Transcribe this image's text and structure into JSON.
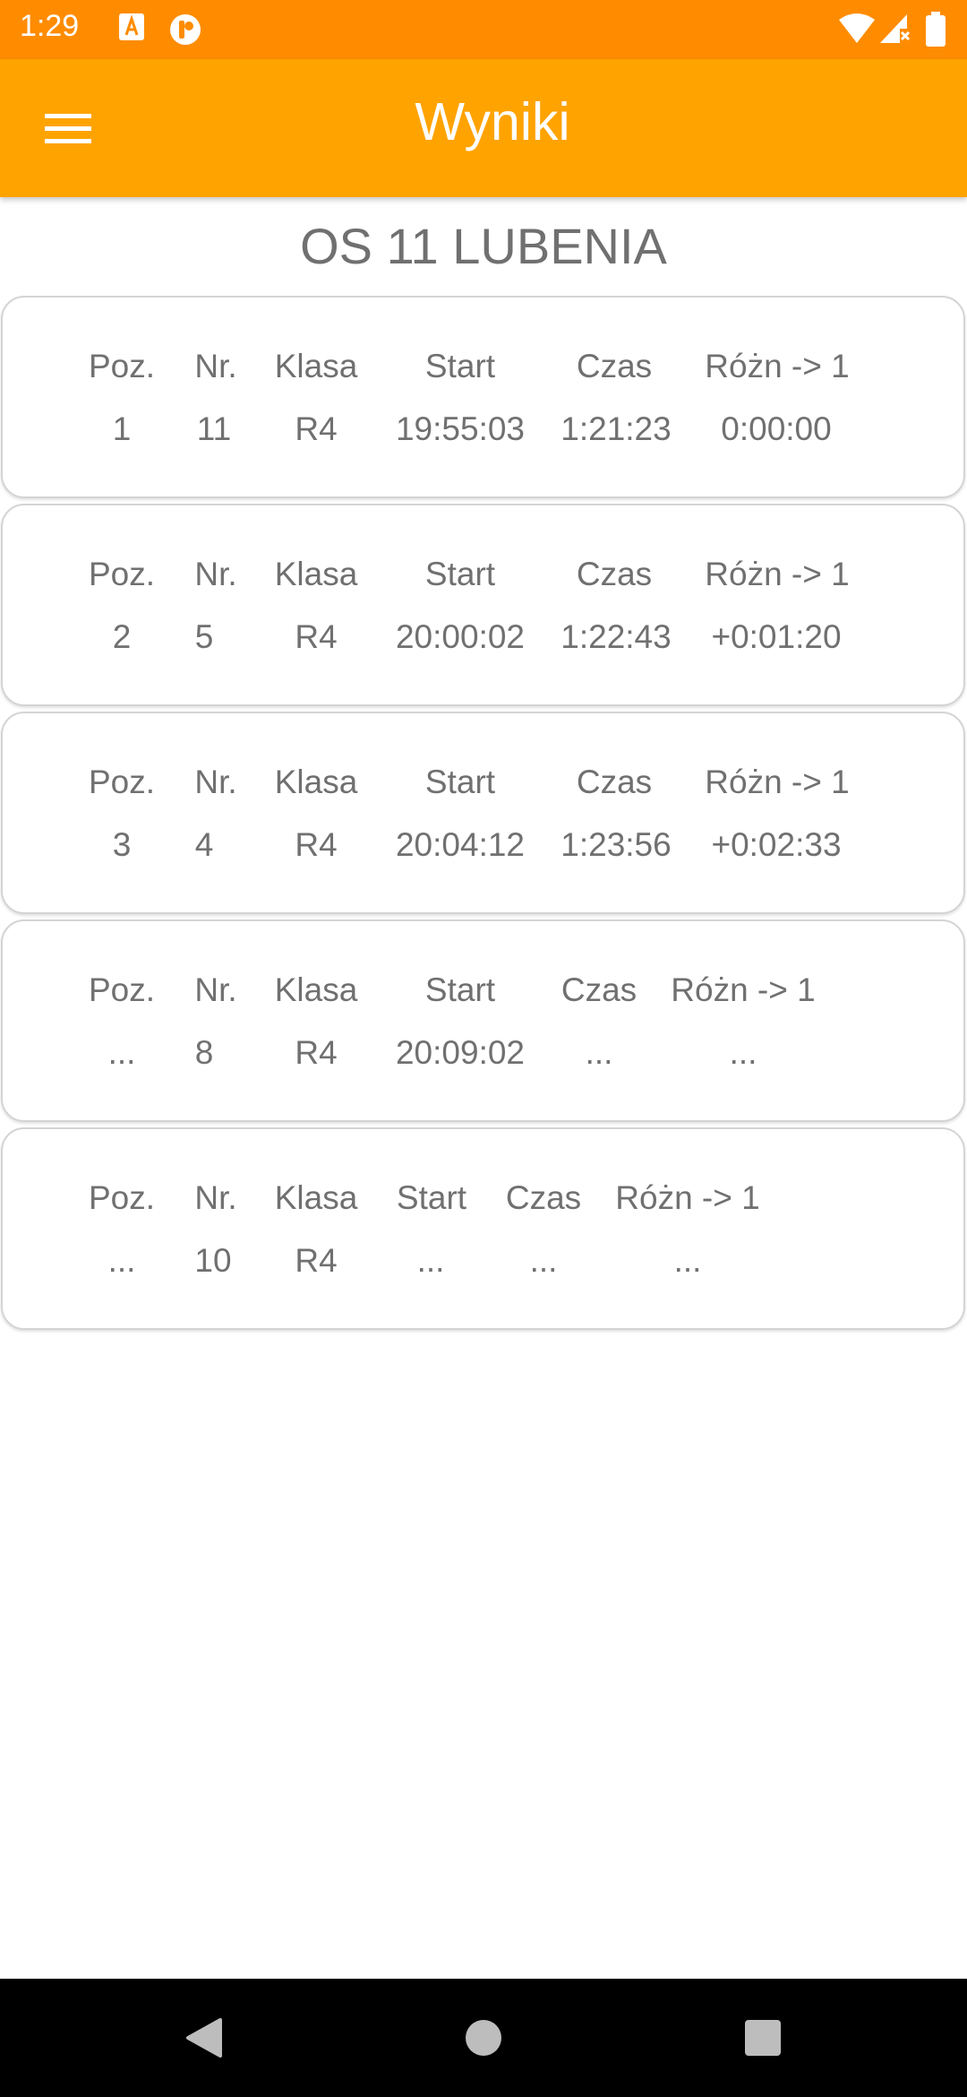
{
  "status_bar": {
    "time": "1:29",
    "icons": [
      "notification-a-icon",
      "notification-app-icon",
      "wifi-icon",
      "signal-icon",
      "battery-icon"
    ]
  },
  "app_bar": {
    "title": "Wyniki",
    "menu_icon": "hamburger-menu-icon",
    "color": "#ffa300"
  },
  "stage": {
    "title": "OS 11 LUBENIA"
  },
  "results": [
    {
      "headers": [
        "Poz.",
        "Nr.",
        "Klasa",
        "Start",
        "Czas",
        "Różn -> 1"
      ],
      "values": [
        "1",
        "11",
        "R4",
        "19:55:03",
        "1:21:23",
        "0:00:00"
      ]
    },
    {
      "headers": [
        "Poz.",
        "Nr.",
        "Klasa",
        "Start",
        "Czas",
        "Różn -> 1"
      ],
      "values": [
        "2",
        "5",
        "R4",
        "20:00:02",
        "1:22:43",
        "+0:01:20"
      ]
    },
    {
      "headers": [
        "Poz.",
        "Nr.",
        "Klasa",
        "Start",
        "Czas",
        "Różn -> 1"
      ],
      "values": [
        "3",
        "4",
        "R4",
        "20:04:12",
        "1:23:56",
        "+0:02:33"
      ]
    },
    {
      "headers": [
        "Poz.",
        "Nr.",
        "Klasa",
        "Start",
        "Czas",
        "Różn -> 1"
      ],
      "values": [
        "...",
        "8",
        "R4",
        "20:09:02",
        "...",
        "..."
      ]
    },
    {
      "headers": [
        "Poz.",
        "Nr.",
        "Klasa",
        "Start",
        "Czas",
        "Różn -> 1"
      ],
      "values": [
        "...",
        "10",
        "R4",
        "...",
        "...",
        "..."
      ]
    }
  ],
  "nav_bar": {
    "icons": [
      "back-icon",
      "home-icon",
      "recents-icon"
    ]
  }
}
